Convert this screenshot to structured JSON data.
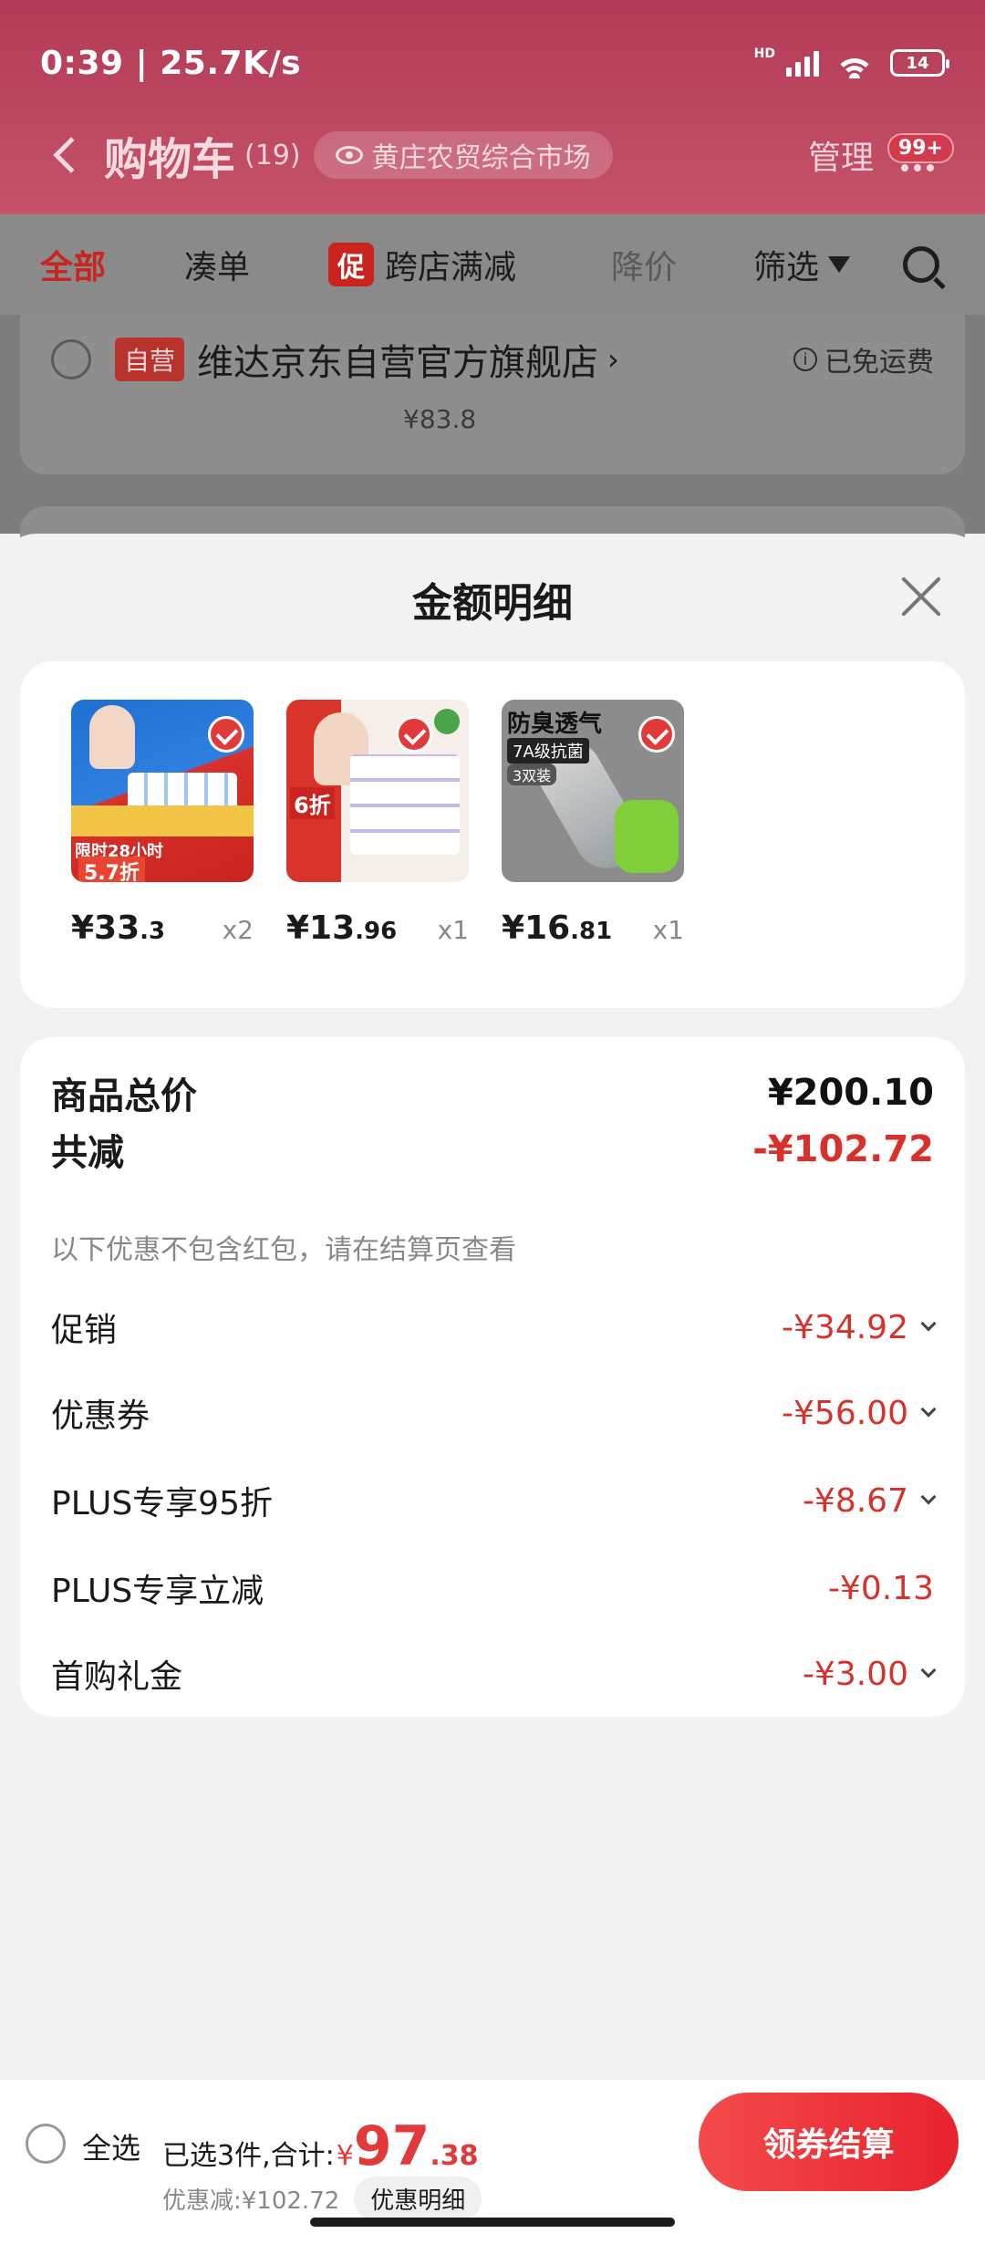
{
  "status_bar": {
    "time": "0:39 | 25.7K/s",
    "network": "HD",
    "battery": "14"
  },
  "nav": {
    "title": "购物车",
    "count": "(19)",
    "market": "黄庄农贸综合市场",
    "manage": "管理",
    "badge": "99+"
  },
  "filters": {
    "all": "全部",
    "bundle": "凑单",
    "promo_tag": "促",
    "promo": "跨店满减",
    "price_drop": "降价",
    "filter": "筛选"
  },
  "store": {
    "tag": "自营",
    "name": "维达京东自营官方旗舰店",
    "arrow": "›",
    "free_shipping": "已免运费",
    "info": "i",
    "price": "¥83.8"
  },
  "sheet": {
    "title": "金额明细",
    "products": [
      {
        "price_int": "¥33",
        "price_dec": ".3",
        "qty": "x2"
      },
      {
        "price_int": "¥13",
        "price_dec": ".96",
        "qty": "x1"
      },
      {
        "price_int": "¥16",
        "price_dec": ".81",
        "qty": "x1"
      }
    ],
    "product_images": {
      "p1_tagline": "限时28小时",
      "p1_discount": "5.7折",
      "p2_badge": "6折",
      "p3_title": "防臭透气",
      "p3_sub": "7A级抗菌",
      "p3_pack": "3双装"
    },
    "summary": {
      "total_label": "商品总价",
      "total_value": "¥200.10",
      "reduce_label": "共减",
      "reduce_value": "-¥102.72",
      "hint": "以下优惠不包含红包，请在结算页查看",
      "lines": [
        {
          "label": "促销",
          "value": "-¥34.92"
        },
        {
          "label": "优惠券",
          "value": "-¥56.00"
        },
        {
          "label": "PLUS专享95折",
          "value": "-¥8.67"
        },
        {
          "label": "PLUS专享立减",
          "value": "-¥0.13"
        },
        {
          "label": "首购礼金",
          "value": "-¥3.00"
        }
      ]
    }
  },
  "bottom": {
    "select_all": "全选",
    "selected": "已选3件,合计:",
    "yen": "¥",
    "price_int": "97",
    "price_dec": ".38",
    "discount": "优惠减:¥102.72",
    "detail_button": "优惠明细",
    "checkout": "领券结算"
  },
  "colors": {
    "accent": "#e23a3a",
    "header": "#b23a55"
  }
}
